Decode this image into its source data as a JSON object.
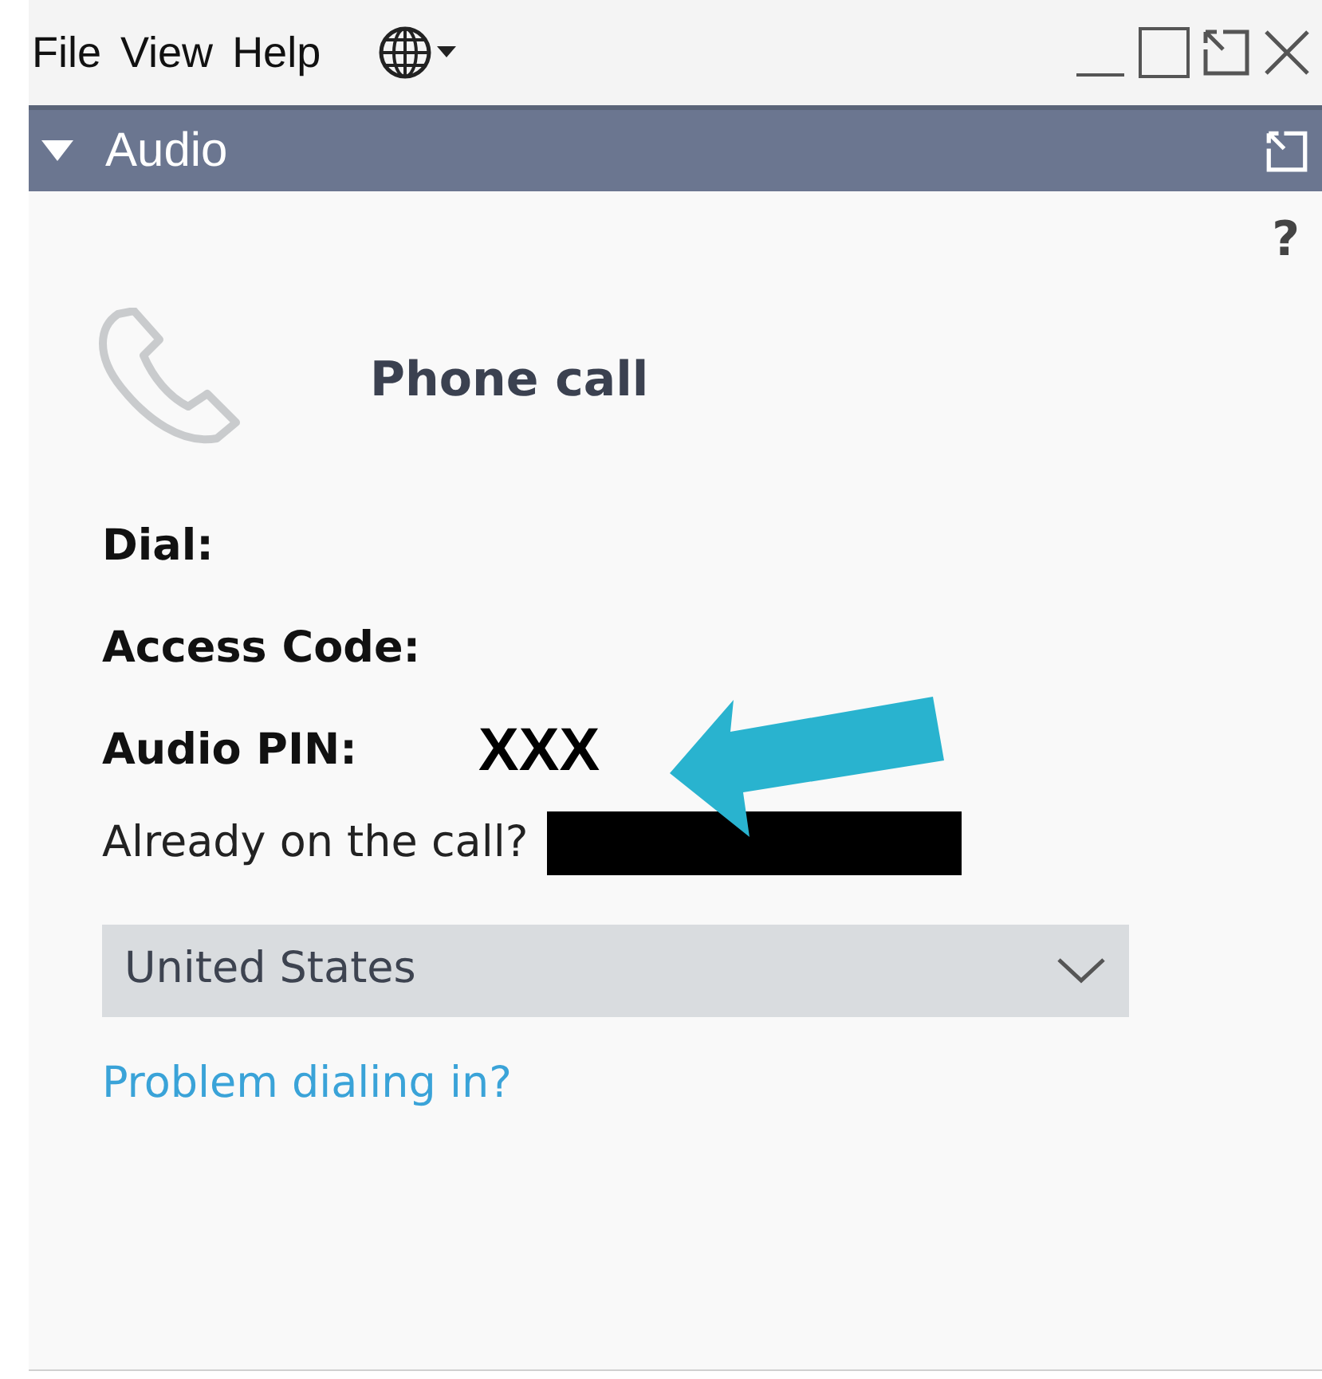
{
  "menu": [
    "File",
    "View",
    "Help"
  ],
  "panel": {
    "title": "Audio",
    "expanded": true
  },
  "help": "?",
  "section_title": "Phone call",
  "fields": [
    {
      "label": "Dial:"
    },
    {
      "label": "Access Code:"
    },
    {
      "label": "Audio PIN:",
      "value": "XXX"
    }
  ],
  "already_on_call": "Already on the call?",
  "country_select": {
    "value": "United States"
  },
  "problem_link": "Problem dialing in?"
}
